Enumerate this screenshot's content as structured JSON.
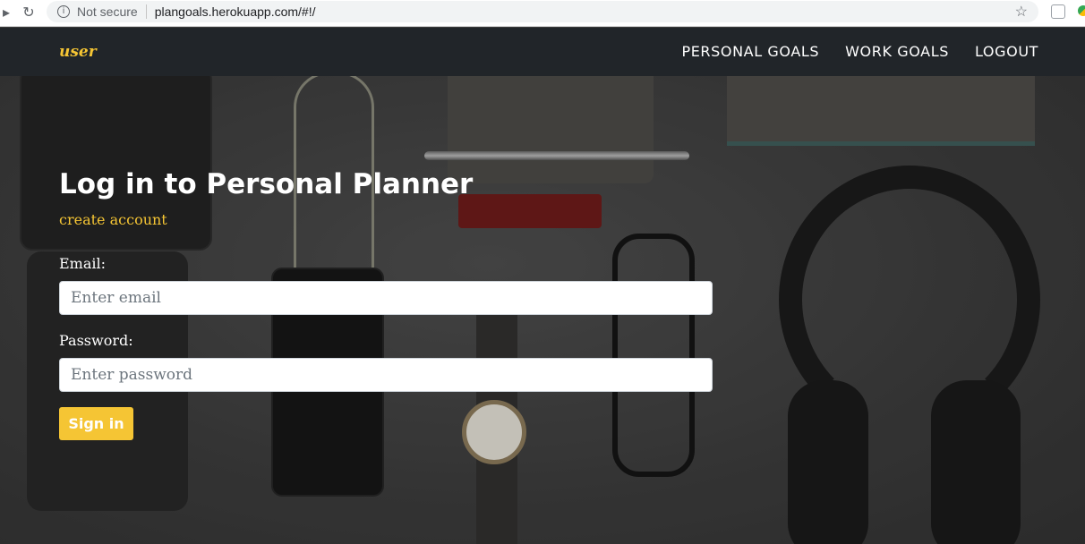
{
  "browser": {
    "security_label": "Not secure",
    "url": "plangoals.herokuapp.com/#!/",
    "icons": [
      "back-icon",
      "reload-icon",
      "info-icon",
      "star-icon"
    ]
  },
  "navbar": {
    "brand": "user",
    "links": [
      "PERSONAL GOALS",
      "WORK GOALS",
      "LOGOUT"
    ],
    "accent_color": "#f5c534",
    "background_color": "#212529"
  },
  "login": {
    "title": "Log in to Personal Planner",
    "create_account": "create account",
    "email_label": "Email:",
    "email_placeholder": "Enter email",
    "password_label": "Password:",
    "password_placeholder": "Enter password",
    "submit_label": "Sign in"
  }
}
